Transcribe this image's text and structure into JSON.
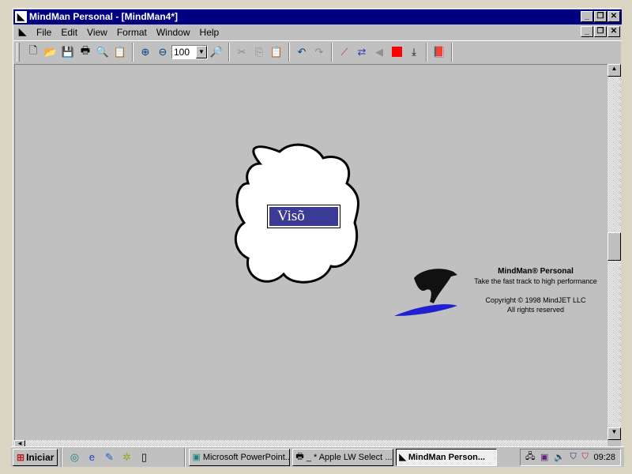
{
  "window": {
    "title": "MindMan Personal - [MindMan4*]",
    "minimize": "_",
    "restore": "❐",
    "close": "✕"
  },
  "menu": [
    {
      "label": "File"
    },
    {
      "label": "Edit"
    },
    {
      "label": "View"
    },
    {
      "label": "Format"
    },
    {
      "label": "Window"
    },
    {
      "label": "Help"
    }
  ],
  "toolbar": {
    "zoom_value": "100"
  },
  "map": {
    "central_topic": "Visõ",
    "topic_fill": "#3b3b96"
  },
  "splash": {
    "product": "MindMan® Personal",
    "tagline": "Take the fast track to high performance",
    "copyright": "Copyright © 1998 MindJET LLC",
    "rights": "All rights reserved"
  },
  "taskbar": {
    "start": "Iniciar",
    "tasks": [
      {
        "label": "Microsoft PowerPoint..."
      },
      {
        "label": "_ * Apple LW Select ..."
      },
      {
        "label": "MindMan Person..."
      }
    ],
    "clock": "09:28"
  }
}
